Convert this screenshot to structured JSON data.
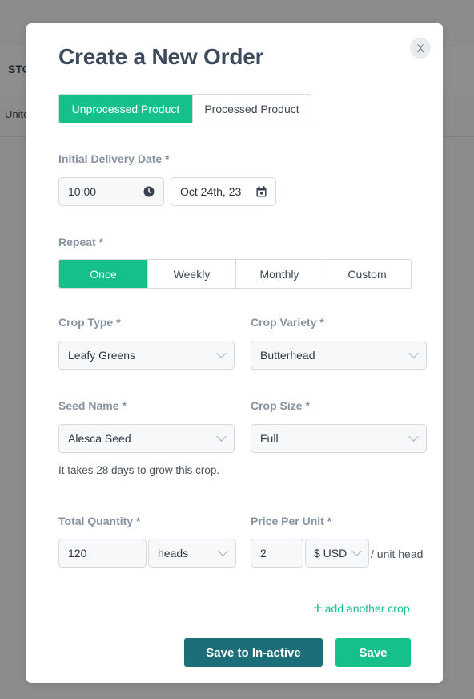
{
  "background": {
    "header_fragment": "STO",
    "cell_fragment": "Unite"
  },
  "modal": {
    "title": "Create a New Order",
    "close_label": "X",
    "product_tabs": [
      {
        "label": "Unprocessed Product",
        "active": true
      },
      {
        "label": "Processed Product",
        "active": false
      }
    ],
    "delivery": {
      "label": "Initial Delivery Date *",
      "time": "10:00",
      "time_icon": "clock-icon",
      "date": "Oct 24th, 23",
      "date_icon": "calendar-icon"
    },
    "repeat": {
      "label": "Repeat *",
      "options": [
        {
          "label": "Once",
          "active": true
        },
        {
          "label": "Weekly",
          "active": false
        },
        {
          "label": "Monthly",
          "active": false
        },
        {
          "label": "Custom",
          "active": false
        }
      ]
    },
    "crop_type": {
      "label": "Crop Type *",
      "value": "Leafy Greens"
    },
    "crop_variety": {
      "label": "Crop Variety *",
      "value": "Butterhead"
    },
    "seed_name": {
      "label": "Seed Name *",
      "value": "Alesca Seed"
    },
    "crop_size": {
      "label": "Crop Size *",
      "value": "Full"
    },
    "grow_hint": "It takes 28 days to grow this crop.",
    "total_quantity": {
      "label": "Total Quantity *",
      "value": "120",
      "unit": "heads"
    },
    "price_per_unit": {
      "label": "Price Per Unit *",
      "value": "2",
      "currency": "$ USD",
      "suffix": "/ unit head"
    },
    "add_crop": {
      "plus": "+",
      "label": "add another crop"
    },
    "actions": {
      "save_inactive": "Save to In-active",
      "save": "Save"
    }
  },
  "colors": {
    "accent": "#16c08a",
    "dark_button": "#1c6f78",
    "label": "#8792a2",
    "title": "#3d4a5c"
  }
}
